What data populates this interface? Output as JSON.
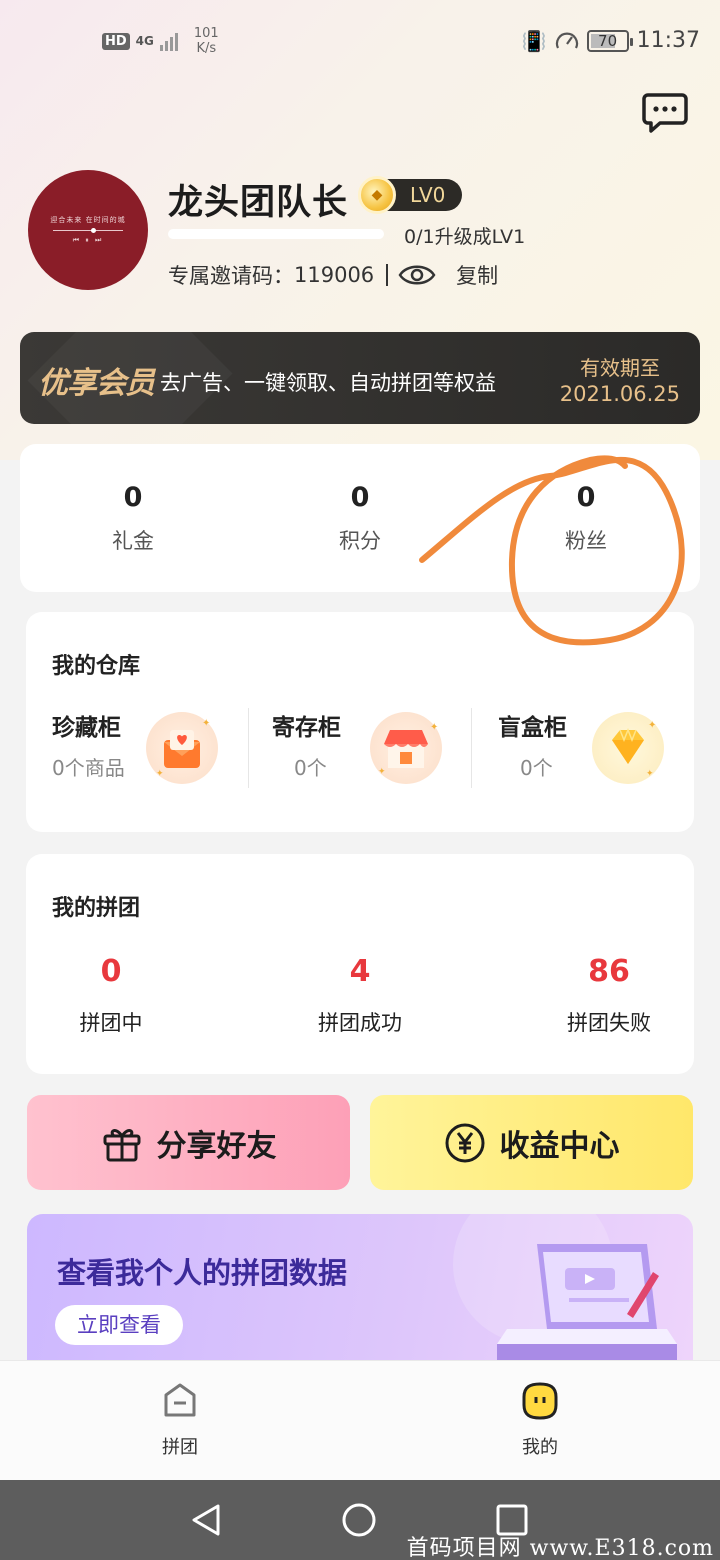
{
  "status_bar": {
    "hd": "HD",
    "signal": "4G",
    "net_speed_value": "101",
    "net_speed_unit": "K/s",
    "battery": "70",
    "time": "11:37"
  },
  "profile": {
    "nickname": "龙头团队长",
    "level": "LV0",
    "level_progress": 0,
    "progress_text": "0/1升级成LV1",
    "invite_label": "专属邀请码：",
    "invite_code": "119006",
    "copy_label": "复制",
    "avatar_line1": "迎合未来 在时间的城",
    "avatar_controls": "⏮ ⏸ ⏭"
  },
  "vip": {
    "logo": "优享会员",
    "desc": "去广告、一键领取、自动拼团等权益",
    "expire_label": "有效期至",
    "expire_date": "2021.06.25"
  },
  "stats": [
    {
      "value": "0",
      "label": "礼金"
    },
    {
      "value": "0",
      "label": "积分"
    },
    {
      "value": "0",
      "label": "粉丝"
    }
  ],
  "storage": {
    "title": "我的仓库",
    "items": [
      {
        "name": "珍藏柜",
        "count": "0个商品",
        "icon": "envelope-heart-icon"
      },
      {
        "name": "寄存柜",
        "count": "0个",
        "icon": "store-icon"
      },
      {
        "name": "盲盒柜",
        "count": "0个",
        "icon": "diamond-icon"
      }
    ]
  },
  "group_buy": {
    "title": "我的拼团",
    "stats": [
      {
        "value": "0",
        "label": "拼团中"
      },
      {
        "value": "4",
        "label": "拼团成功"
      },
      {
        "value": "86",
        "label": "拼团失败"
      }
    ]
  },
  "actions": {
    "share_label": "分享好友",
    "income_label": "收益中心"
  },
  "data_banner": {
    "title": "查看我个人的拼团数据",
    "button": "立即查看"
  },
  "bottom_nav": [
    {
      "label": "拼团",
      "icon": "group-buy-icon"
    },
    {
      "label": "我的",
      "icon": "profile-face-icon"
    }
  ],
  "watermark": "首码项目网 www.E318.com",
  "colors": {
    "accent_red": "#e8383d",
    "vip_gold": "#e7c08a",
    "annotation_orange": "#f08a3c"
  }
}
